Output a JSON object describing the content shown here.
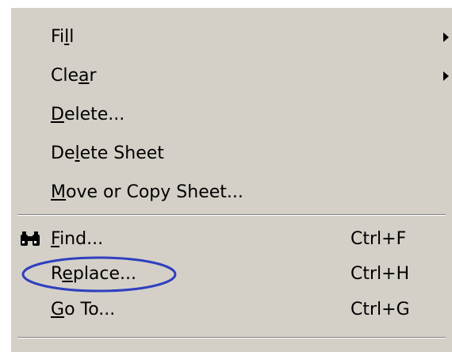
{
  "menu": {
    "items": [
      {
        "pre": "Fi",
        "ul": "l",
        "post": "l",
        "shortcut": "",
        "submenu": true
      },
      {
        "pre": "Cle",
        "ul": "a",
        "post": "r",
        "shortcut": "",
        "submenu": true
      },
      {
        "pre": "",
        "ul": "D",
        "post": "elete...",
        "shortcut": "",
        "submenu": false
      },
      {
        "pre": "De",
        "ul": "l",
        "post": "ete Sheet",
        "shortcut": "",
        "submenu": false
      },
      {
        "pre": "",
        "ul": "M",
        "post": "ove or Copy Sheet...",
        "shortcut": "",
        "submenu": false
      },
      {
        "pre": "",
        "ul": "F",
        "post": "ind...",
        "shortcut": "Ctrl+F",
        "icon": "binoculars-icon",
        "submenu": false
      },
      {
        "pre": "R",
        "ul": "e",
        "post": "place...",
        "shortcut": "Ctrl+H",
        "submenu": false,
        "annotated": true
      },
      {
        "pre": "",
        "ul": "G",
        "post": "o To...",
        "shortcut": "Ctrl+G",
        "submenu": false
      }
    ]
  },
  "colors": {
    "menu_background": "#d4d0c8",
    "text": "#000000",
    "annotation_ellipse": "#2f3fbf"
  }
}
